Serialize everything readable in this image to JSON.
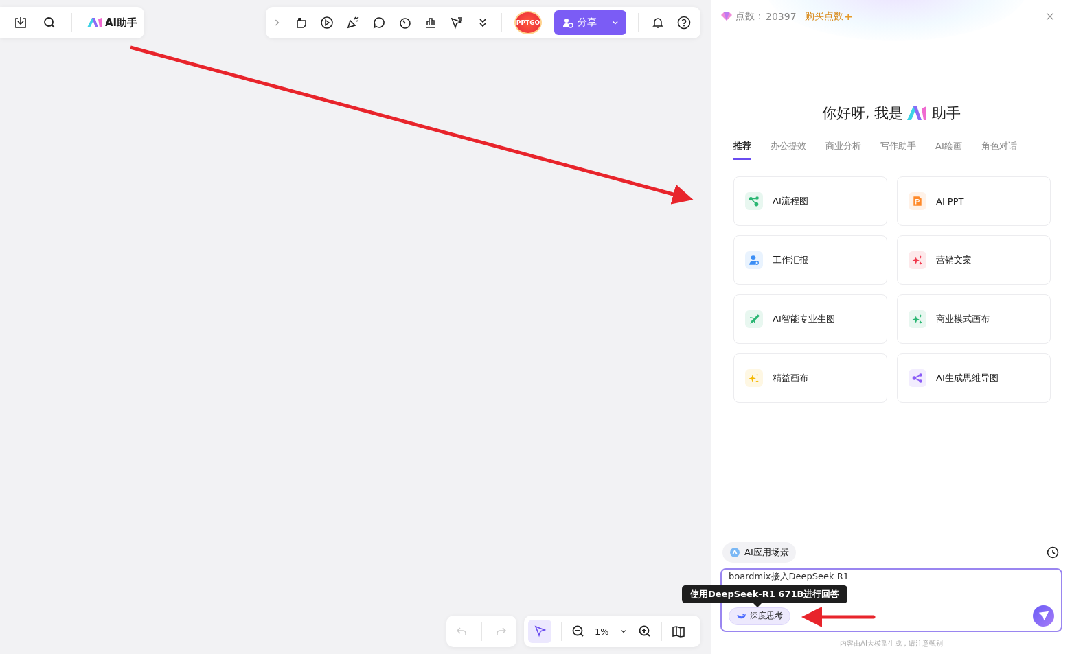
{
  "left_toolbar": {
    "ai_button": "AI助手"
  },
  "top_toolbar": {
    "avatar": "PPTGO",
    "share": "分享"
  },
  "bottom_toolbar": {
    "select_tool_selected": true,
    "zoom": "1%"
  },
  "ai_panel": {
    "points_label": "点数：",
    "points": "20397",
    "buy": "购买点数",
    "greeting_prefix": "你好呀, 我是",
    "greeting_suffix": "助手",
    "tabs": [
      {
        "label": "推荐",
        "selected": true
      },
      {
        "label": "办公提效",
        "selected": false
      },
      {
        "label": "商业分析",
        "selected": false
      },
      {
        "label": "写作助手",
        "selected": false
      },
      {
        "label": "AI绘画",
        "selected": false
      },
      {
        "label": "角色对话",
        "selected": false
      }
    ],
    "cards": [
      {
        "label": "AI流程图",
        "kind": "flow",
        "color": "#2bb673"
      },
      {
        "label": "AI PPT",
        "kind": "ppt",
        "color": "#ff8a2b"
      },
      {
        "label": "工作汇报",
        "kind": "report",
        "color": "#3b8ef5"
      },
      {
        "label": "营销文案",
        "kind": "sparkle",
        "color": "#f0394d"
      },
      {
        "label": "AI智能专业生图",
        "kind": "pen",
        "color": "#2bb673"
      },
      {
        "label": "商业模式画布",
        "kind": "sparkle",
        "color": "#2bb673"
      },
      {
        "label": "精益画布",
        "kind": "sparkle",
        "color": "#f5b800"
      },
      {
        "label": "AI生成思维导图",
        "kind": "mindmap",
        "color": "#8a5cf6"
      }
    ],
    "scene_chip": "AI应用场景",
    "input": {
      "value": "boardmix接入DeepSeek R1"
    },
    "deep_think": {
      "label": "深度思考",
      "selected": true
    },
    "tooltip": "使用DeepSeek-R1 671B进行回答",
    "disclaimer": "内容由AI大模型生成，请注意甄别"
  }
}
